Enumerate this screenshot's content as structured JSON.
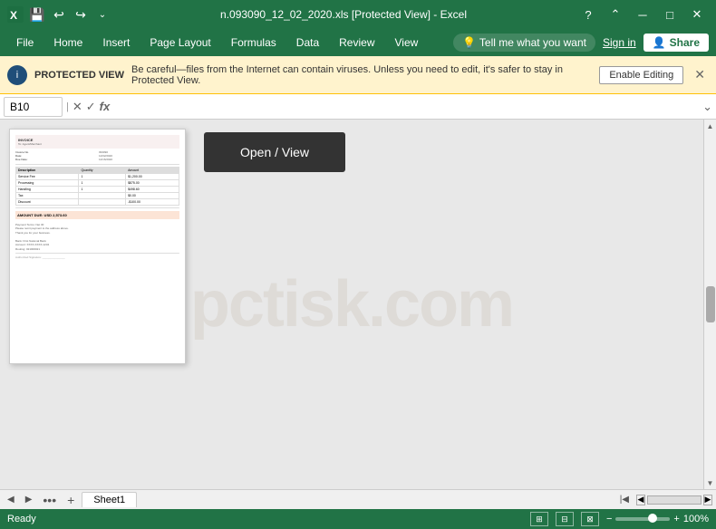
{
  "titlebar": {
    "filename": "n.093090_12_02_2020.xls [Protected View] - Excel",
    "save_icon": "💾",
    "undo_icon": "↩",
    "redo_icon": "↪",
    "minimize_icon": "─",
    "maximize_icon": "□",
    "close_icon": "✕",
    "options_icon": "⌄"
  },
  "menubar": {
    "items": [
      "File",
      "Home",
      "Insert",
      "Page Layout",
      "Formulas",
      "Data",
      "Review",
      "View"
    ],
    "tell_me_placeholder": "Tell me what you want",
    "tell_me_icon": "💡",
    "sign_in_label": "Sign in",
    "share_icon": "👤",
    "share_label": "Share"
  },
  "protected_view": {
    "badge_label": "PROTECTED VIEW",
    "shield_icon": "🛡",
    "message": "Be careful—files from the Internet can contain viruses. Unless you need to edit, it's safer to stay in Protected View.",
    "enable_label": "Enable Editing",
    "close_icon": "✕"
  },
  "formula_bar": {
    "cell_ref": "B10",
    "cancel_icon": "✕",
    "confirm_icon": "✓",
    "function_icon": "fx",
    "value": "",
    "expand_icon": "⌄"
  },
  "main": {
    "open_view_label": "Open / View",
    "watermark": "pctisk.com"
  },
  "tabs": {
    "prev_icon": "◀",
    "next_icon": "▶",
    "sheet_label": "Sheet1",
    "dots_icon": "•••",
    "add_icon": "+"
  },
  "statusbar": {
    "ready_label": "Ready",
    "view_normal_icon": "⊞",
    "view_layout_icon": "⊟",
    "view_page_icon": "⊠",
    "zoom_minus": "−",
    "zoom_plus": "+",
    "zoom_level": "100%"
  }
}
